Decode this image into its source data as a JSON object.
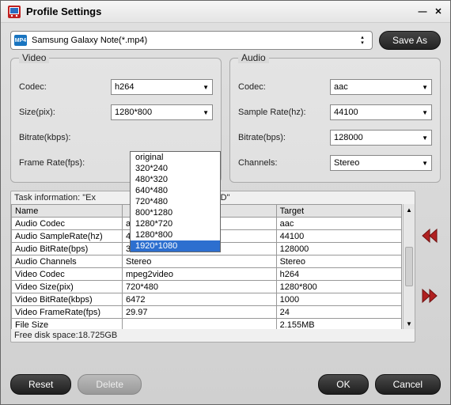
{
  "window_title": "Profile Settings",
  "profile": {
    "selected": "Samsung Galaxy Note(*.mp4)",
    "mini_label": "MP4"
  },
  "buttons": {
    "save_as": "Save As",
    "reset": "Reset",
    "delete": "Delete",
    "ok": "OK",
    "cancel": "Cancel"
  },
  "video": {
    "legend": "Video",
    "codec_label": "Codec:",
    "codec_value": "h264",
    "size_label": "Size(pix):",
    "size_value": "1280*800",
    "bitrate_label": "Bitrate(kbps):",
    "bitrate_value": "",
    "framerate_label": "Frame Rate(fps):",
    "framerate_value": ""
  },
  "size_options": [
    "original",
    "320*240",
    "480*320",
    "640*480",
    "720*480",
    "800*1280",
    "1280*720",
    "1280*800",
    "1920*1080"
  ],
  "size_selected_index": 8,
  "audio": {
    "legend": "Audio",
    "codec_label": "Codec:",
    "codec_value": "aac",
    "samplerate_label": "Sample Rate(hz):",
    "samplerate_value": "44100",
    "bitrate_label": "Bitrate(bps):",
    "bitrate_value": "128000",
    "channels_label": "Channels:",
    "channels_value": "Stereo"
  },
  "task": {
    "title_prefix": "Task information: \"Ex",
    "title_suffix": "IDEO.MOD\"",
    "headers": [
      "Name",
      "",
      "Target"
    ],
    "rows": [
      [
        "Audio Codec",
        "ac3",
        "aac"
      ],
      [
        "Audio SampleRate(hz)",
        "48000",
        "44100"
      ],
      [
        "Audio BitRate(bps)",
        "384000",
        "128000"
      ],
      [
        "Audio Channels",
        "Stereo",
        "Stereo"
      ],
      [
        "Video Codec",
        "mpeg2video",
        "h264"
      ],
      [
        "Video Size(pix)",
        "720*480",
        "1280*800"
      ],
      [
        "Video BitRate(kbps)",
        "6472",
        "1000"
      ],
      [
        "Video FrameRate(fps)",
        "29.97",
        "24"
      ],
      [
        "File Size",
        "",
        "2.155MB"
      ]
    ],
    "free_disk": "Free disk space:18.725GB"
  }
}
